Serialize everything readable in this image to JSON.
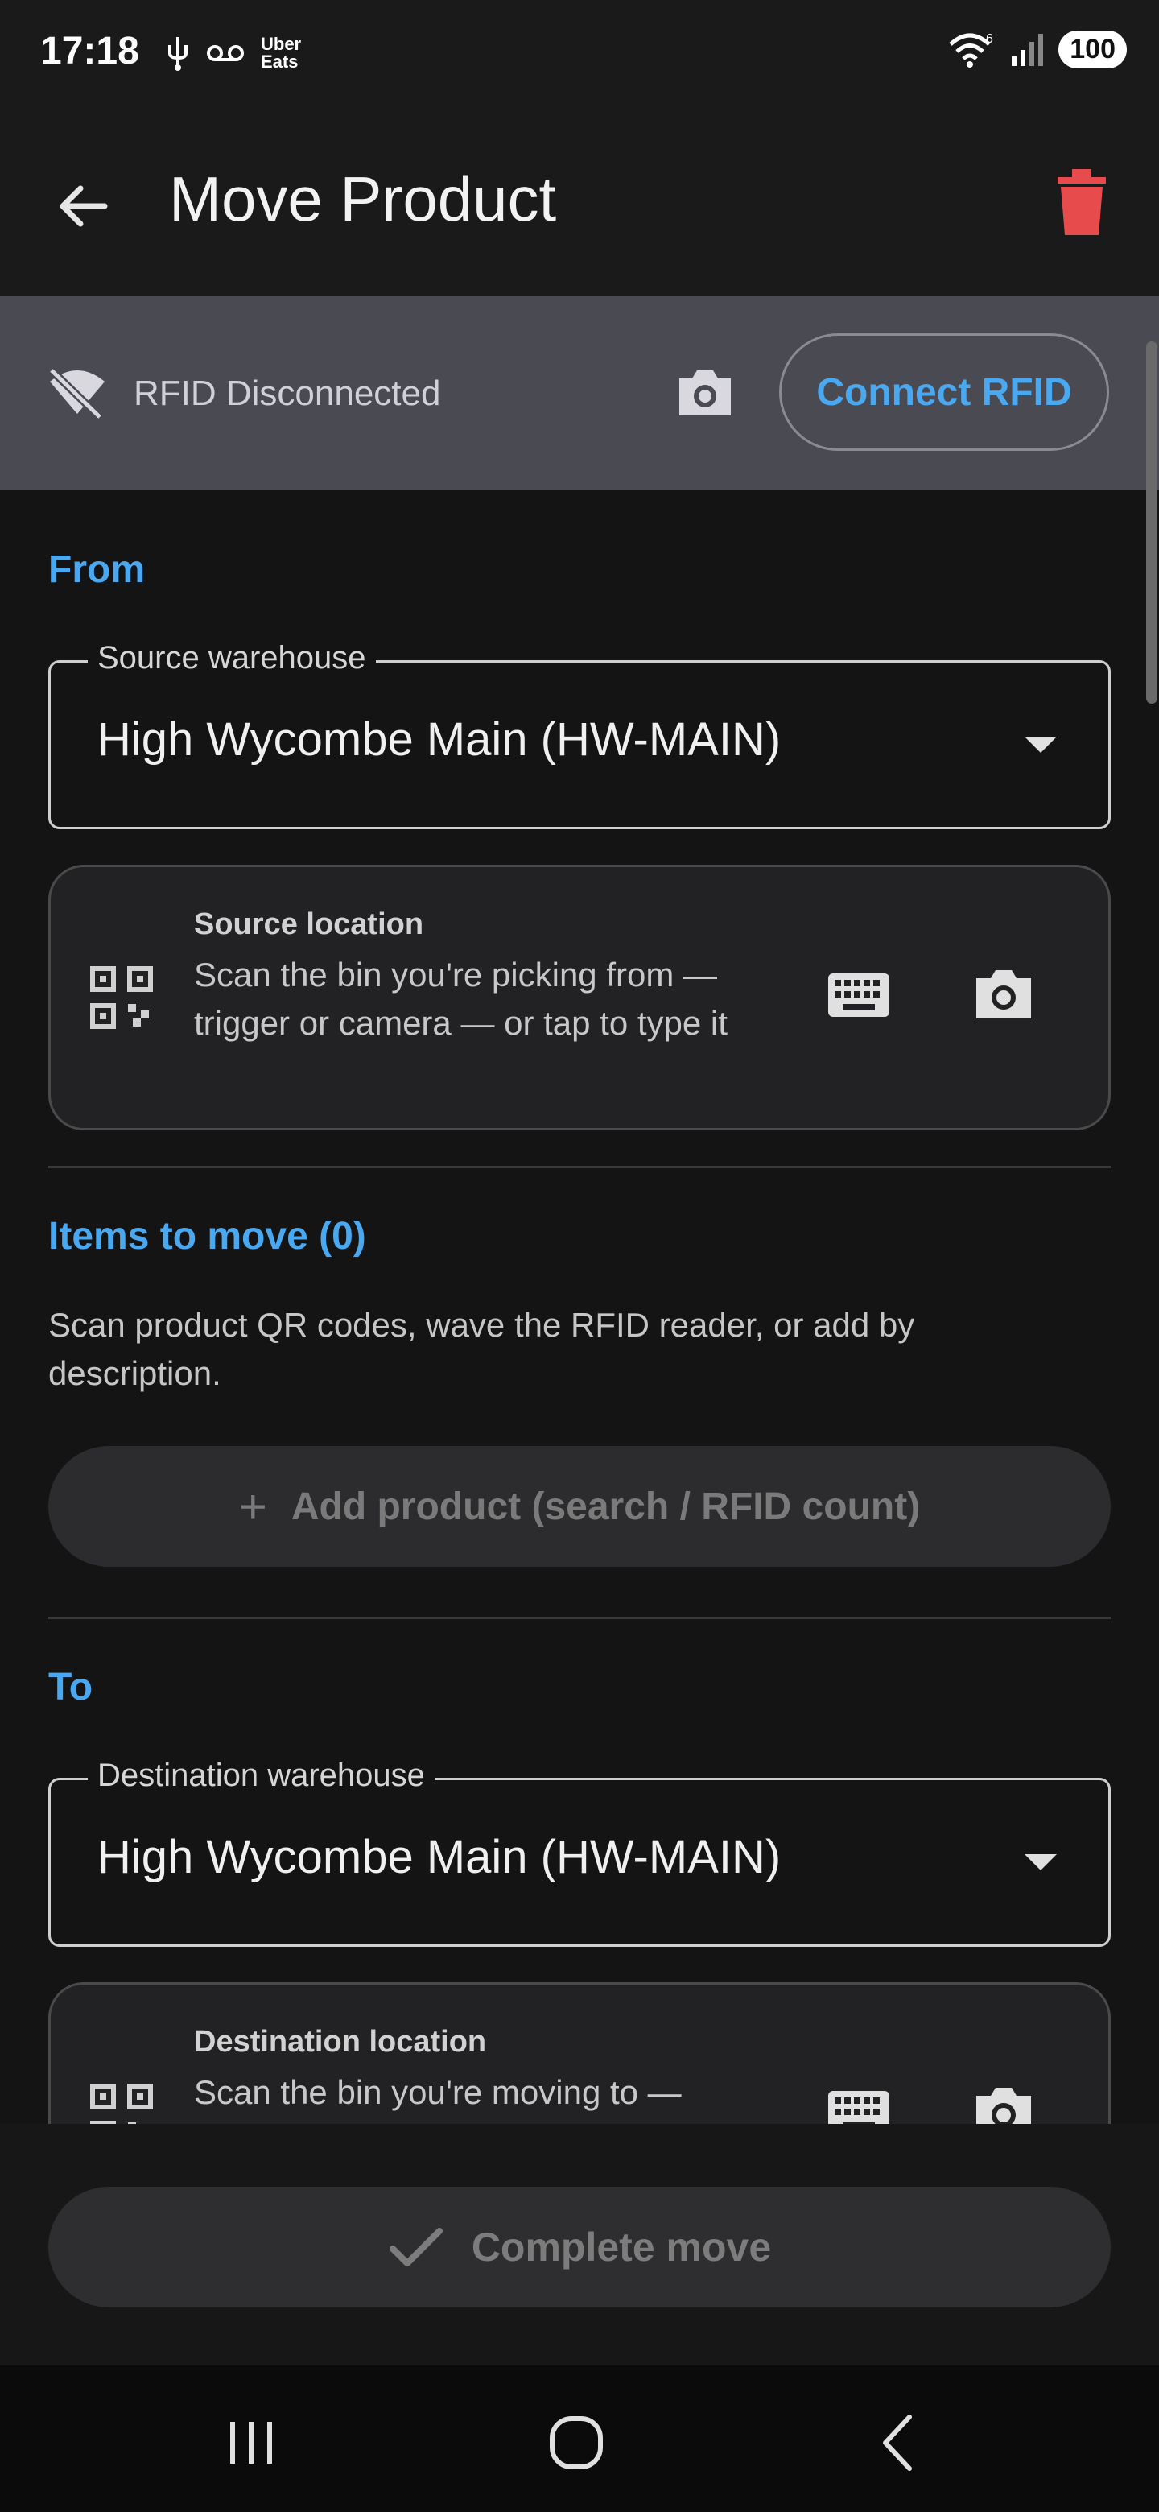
{
  "status_bar": {
    "time": "17:18",
    "uber_line1": "Uber",
    "uber_line2": "Eats",
    "wifi_badge": "6",
    "battery": "100"
  },
  "app_bar": {
    "title": "Move Product"
  },
  "rfid": {
    "status": "RFID Disconnected",
    "connect_label": "Connect RFID"
  },
  "from": {
    "section_title": "From",
    "warehouse_label": "Source warehouse",
    "warehouse_value": "High Wycombe Main (HW-MAIN)",
    "location_heading": "Source location",
    "location_desc": "Scan the bin you're picking from — trigger or camera — or tap to type it"
  },
  "items": {
    "section_title": "Items to move (0)",
    "hint": "Scan product QR codes, wave the RFID reader, or add by description.",
    "add_label": "Add product (search / RFID count)"
  },
  "to": {
    "section_title": "To",
    "warehouse_label": "Destination warehouse",
    "warehouse_value": "High Wycombe Main (HW-MAIN)",
    "location_heading": "Destination location",
    "location_desc": "Scan the bin you're moving to —"
  },
  "footer": {
    "complete_label": "Complete move"
  },
  "colors": {
    "accent": "#4aa8f0",
    "delete": "#e84b4b",
    "background": "#141414"
  }
}
